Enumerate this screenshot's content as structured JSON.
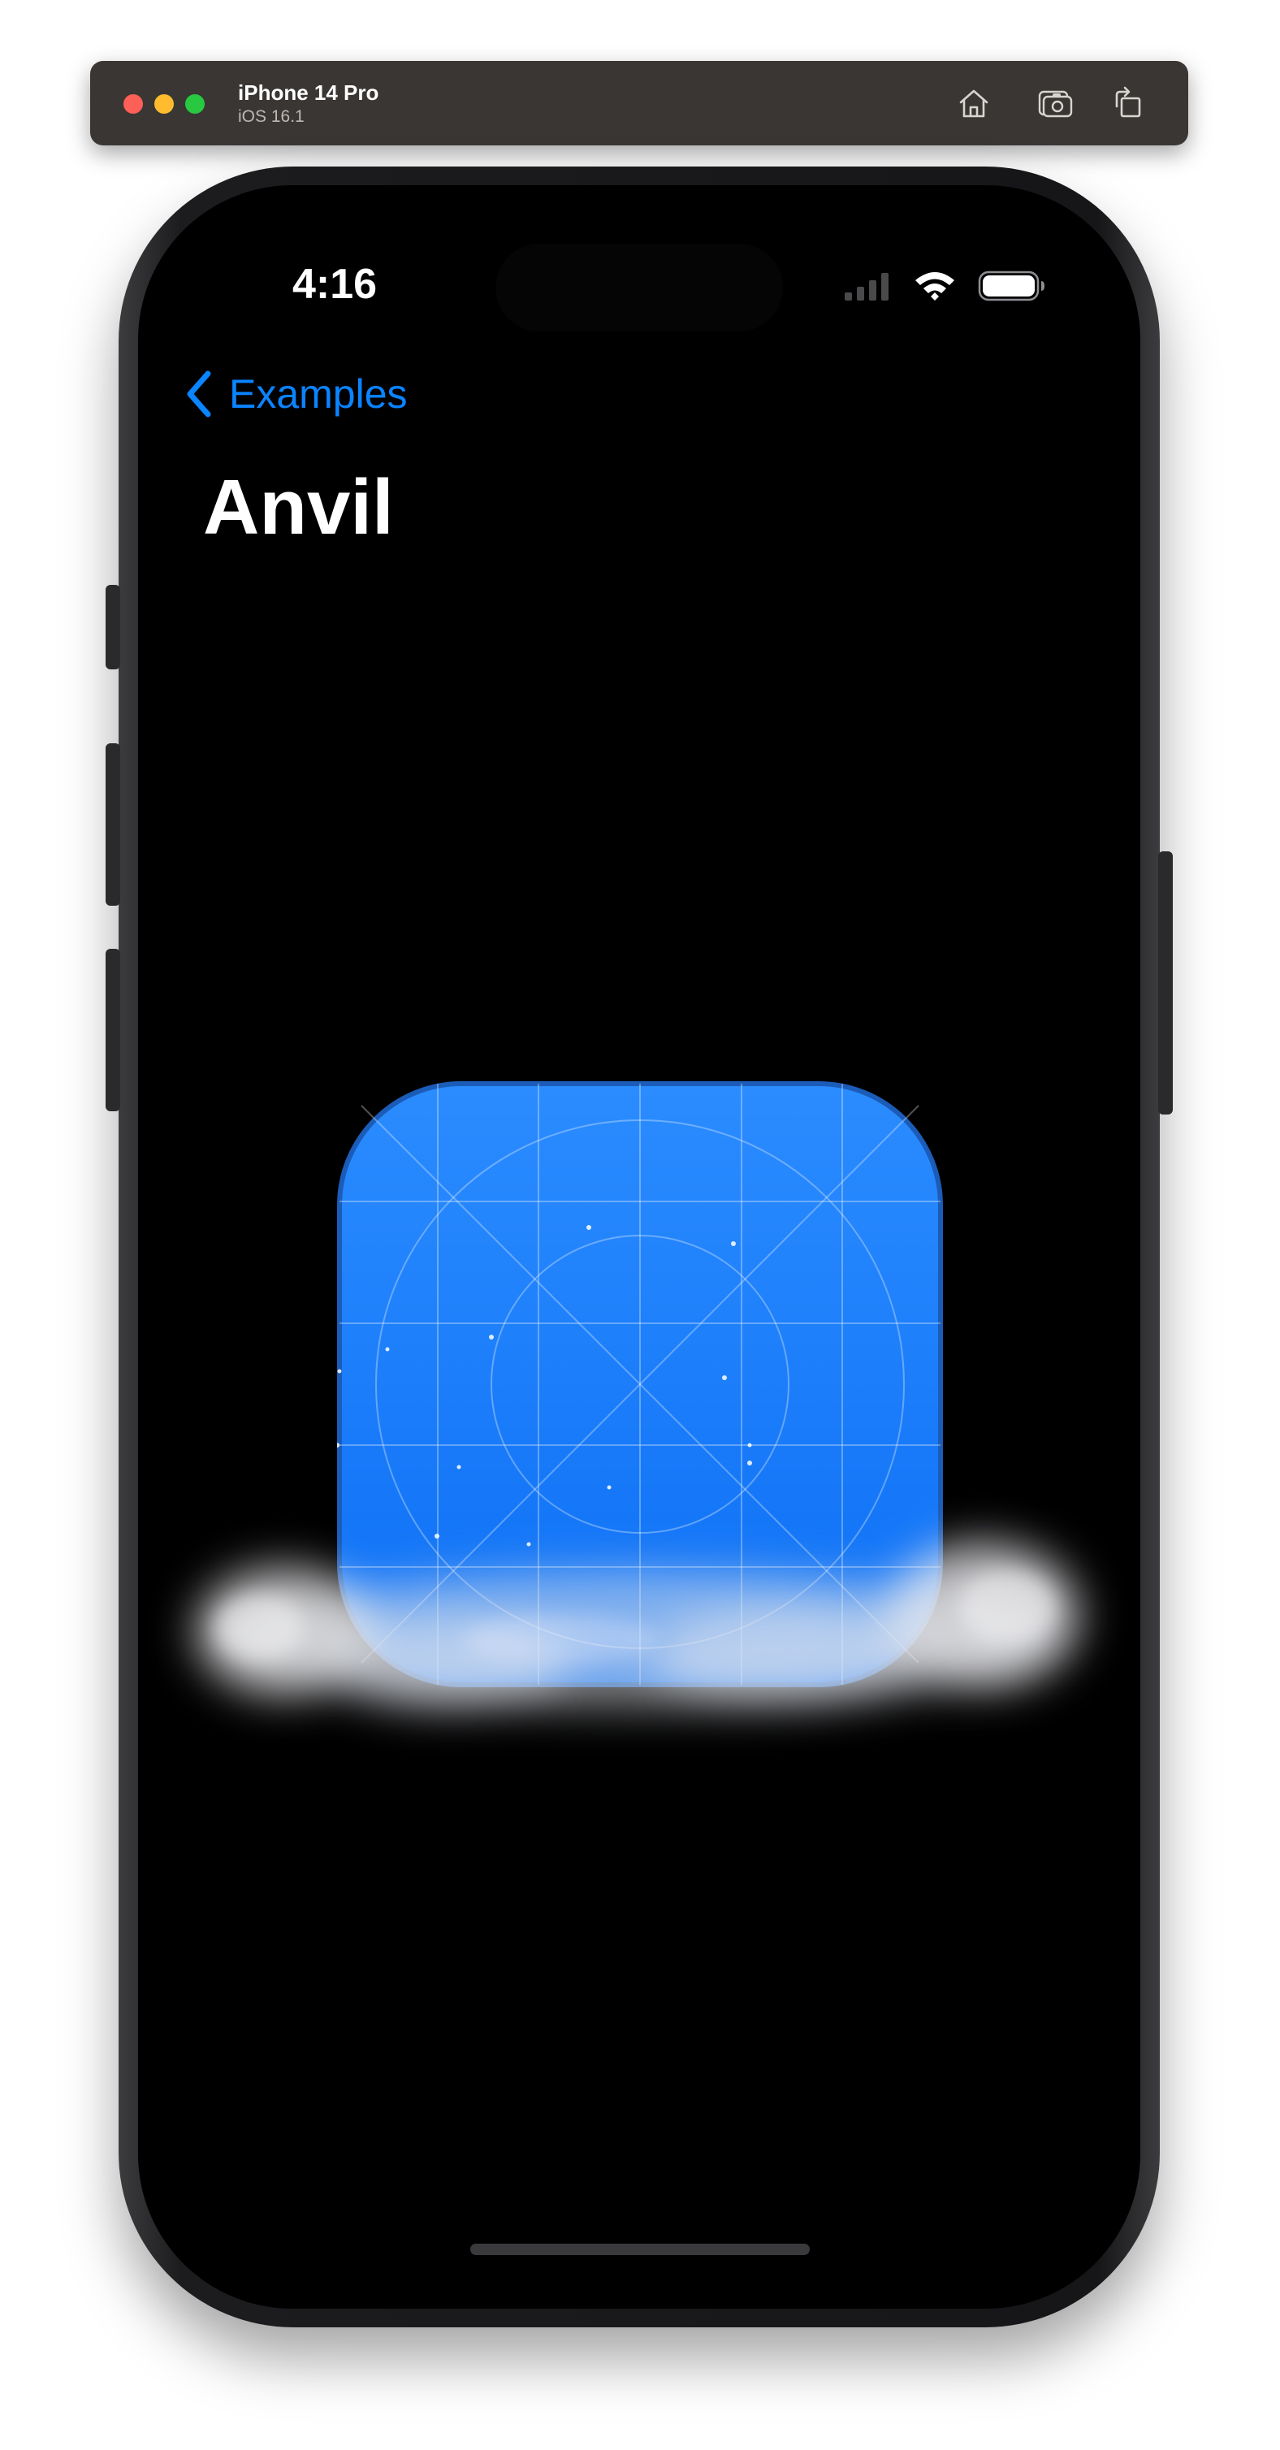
{
  "simulator": {
    "device_name": "iPhone 14 Pro",
    "os_version": "iOS 16.1",
    "toolbar": {
      "home_icon": "home-icon",
      "screenshot_icon": "camera-icon",
      "rotate_icon": "rotate-icon"
    }
  },
  "status_bar": {
    "time": "4:16",
    "icons": [
      "cellular-signal-icon",
      "wifi-icon",
      "battery-icon"
    ]
  },
  "nav": {
    "back_label": "Examples",
    "title": "Anvil"
  },
  "colors": {
    "accent": "#0a84ff",
    "background": "#000000",
    "icon_top": "#2b8cff",
    "icon_bottom": "#0c6ff5"
  },
  "content": {
    "icon": "app-icon-grid-template",
    "effect": "smoke-cloud"
  }
}
